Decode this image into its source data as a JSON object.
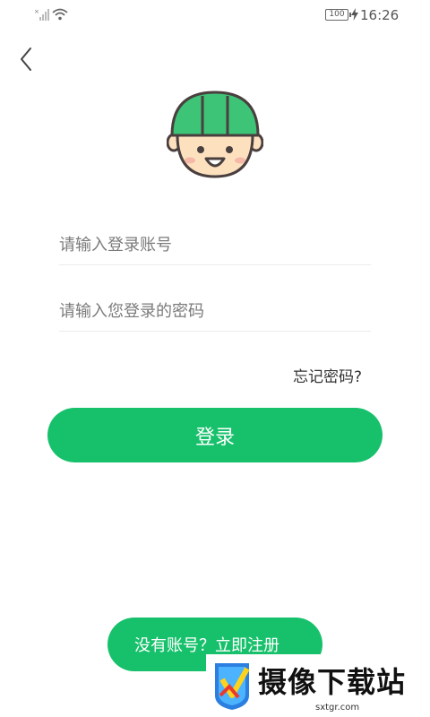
{
  "status_bar": {
    "battery": "100",
    "time": "16:26"
  },
  "login": {
    "account_placeholder": "请输入登录账号",
    "password_placeholder": "请输入您登录的密码",
    "forgot_label": "忘记密码?",
    "login_label": "登录",
    "register_label": "没有账号？立即注册"
  },
  "watermark": {
    "title": "摄像下载站",
    "url": "sxtgr.com"
  },
  "colors": {
    "accent": "#17c16b",
    "helmet": "#3ec477",
    "face": "#fde1bf"
  },
  "icons": [
    "signal-icon",
    "wifi-icon",
    "battery-icon",
    "charging-icon",
    "back-arrow-icon",
    "worker-avatar-icon"
  ]
}
